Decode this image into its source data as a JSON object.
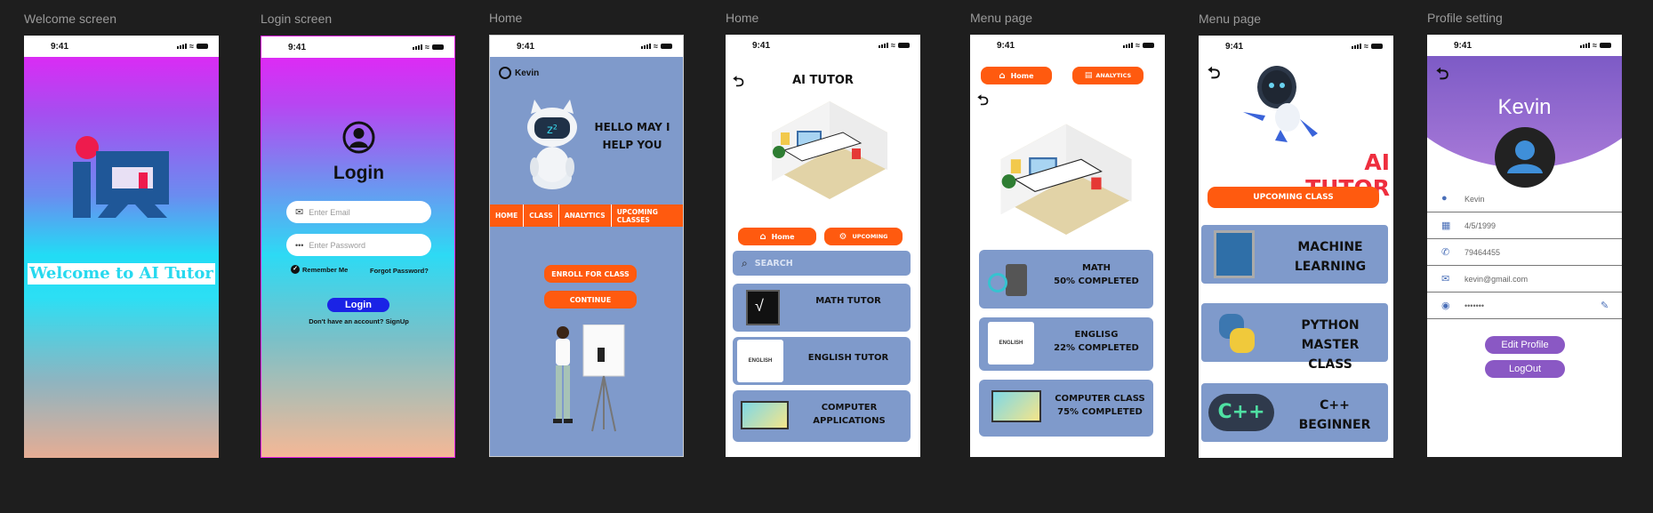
{
  "frames": {
    "welcome": {
      "label": "Welcome screen",
      "time": "9:41",
      "title": "Welcome to AI Tutor"
    },
    "login": {
      "label": "Login screen",
      "time": "9:41",
      "heading": "Login",
      "email_placeholder": "Enter Email",
      "password_placeholder": "Enter Password",
      "remember": "Remember Me",
      "forgot": "Forgot Password?",
      "login_button": "Login",
      "signup_text": "Don't have an account? SignUp"
    },
    "home1": {
      "label": "Home",
      "time": "9:41",
      "user": "Kevin",
      "greeting_line1": "HELLO MAY I",
      "greeting_line2": "HELP YOU",
      "nav": [
        "HOME",
        "CLASS",
        "ANALYTICS",
        "UPCOMING CLASSES"
      ],
      "enroll": "ENROLL FOR CLASS",
      "continue": "CONTINUE"
    },
    "home2": {
      "label": "Home",
      "time": "9:41",
      "title": "AI TUTOR",
      "home_button": "Home",
      "upcoming_button": "UPCOMING",
      "search_placeholder": "SEARCH",
      "courses": [
        {
          "line1": "MATH TUTOR",
          "line2": ""
        },
        {
          "line1": "ENGLISH TUTOR",
          "line2": ""
        },
        {
          "line1": "COMPUTER",
          "line2": "APPLICATIONS"
        }
      ]
    },
    "menu1": {
      "label": "Menu page",
      "time": "9:41",
      "home_button": "Home",
      "analytics_button": "ANALYTICS",
      "progress": [
        {
          "line1": "MATH",
          "line2": "50% COMPLETED",
          "value": 50
        },
        {
          "line1": "ENGLISG",
          "line2": "22% COMPLETED",
          "value": 22
        },
        {
          "line1": "COMPUTER CLASS",
          "line2": "75% COMPLETED",
          "value": 75
        }
      ]
    },
    "menu2": {
      "label": "Menu page",
      "time": "9:41",
      "title": "AI TUTOR",
      "upcoming": "UPCOMING CLASS",
      "classes": [
        {
          "line1": "MACHINE",
          "line2": "LEARNING"
        },
        {
          "line1": "PYTHON MASTER",
          "line2": "CLASS"
        },
        {
          "line1": "C++",
          "line2": "BEGINNER"
        }
      ]
    },
    "profile": {
      "label": "Profile setting",
      "time": "9:41",
      "name": "Kevin",
      "fields": {
        "name": "Kevin",
        "dob": "4/5/1999",
        "phone": "79464455",
        "email": "kevin@gmail.com",
        "password": "•••••••"
      },
      "edit_button": "Edit Profile",
      "logout_button": "LogOut"
    }
  },
  "colors": {
    "orange": "#ff5a0f",
    "card_blue": "#7f9acb",
    "purple": "#8a58c4",
    "login_blue": "#1a23e6"
  }
}
